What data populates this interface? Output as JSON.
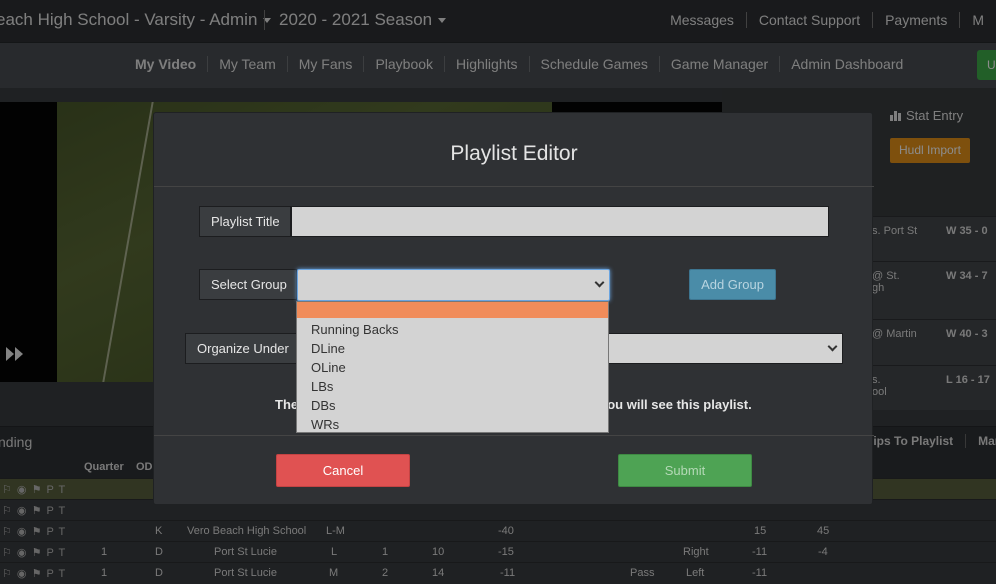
{
  "header": {
    "team_title": "each High School - Varsity - Admin",
    "season": "2020 - 2021 Season",
    "links": [
      "Messages",
      "Contact Support",
      "Payments",
      "M"
    ]
  },
  "nav": {
    "items": [
      "My Video",
      "My Team",
      "My Fans",
      "Playbook",
      "Highlights",
      "Schedule Games",
      "Game Manager",
      "Admin Dashboard"
    ],
    "green_button": "U"
  },
  "side": {
    "stat_entry": "Stat Entry",
    "hudl_import": "Hudl Import",
    "games": [
      {
        "opp": "s. Port St",
        "res": "W 35 - 0"
      },
      {
        "opp": "@ St.\ngh",
        "res": "W 34 - 7"
      },
      {
        "opp": "@ Martin",
        "res": "W 40 - 3"
      },
      {
        "opp": "s.\nool",
        "res": "L 16 - 17"
      }
    ]
  },
  "bottom": {
    "left": "nding",
    "right_1": "lips To Playlist",
    "right_2": "Man"
  },
  "grid": {
    "headers": [
      "Quarter",
      "ODI"
    ],
    "rows": [
      {
        "icons": "",
        "cells": [
          "",
          "",
          "",
          "",
          "",
          "",
          "",
          "",
          "",
          "",
          "",
          ""
        ]
      },
      {
        "icons": "",
        "cells": [
          "",
          "",
          "",
          "",
          "",
          "",
          "",
          "",
          "",
          "",
          "",
          ""
        ]
      },
      {
        "icons": "",
        "cells": [
          "",
          "K",
          "Vero Beach High School",
          "L-M",
          "",
          "",
          "-40",
          "",
          "",
          "",
          "15",
          "45"
        ]
      },
      {
        "icons": "",
        "cells": [
          "1",
          "D",
          "Port St Lucie",
          "L",
          "1",
          "10",
          "-15",
          "",
          "",
          "Right",
          "-11",
          "-4"
        ]
      },
      {
        "icons": "",
        "cells": [
          "1",
          "D",
          "Port St Lucie",
          "M",
          "2",
          "14",
          "-11",
          "",
          "Pass",
          "Left",
          "-11",
          ""
        ]
      }
    ]
  },
  "modal": {
    "title": "Playlist Editor",
    "playlist_title_label": "Playlist Title",
    "playlist_title_value": "",
    "select_group_label": "Select Group",
    "add_group": "Add Group",
    "organize_label": "Organize Under",
    "hint_left": "The",
    "hint_right": "you will see this playlist.",
    "cancel": "Cancel",
    "submit": "Submit",
    "group_options": [
      "",
      "Running Backs",
      "DLine",
      "OLine",
      "LBs",
      "DBs",
      "WRs"
    ]
  }
}
